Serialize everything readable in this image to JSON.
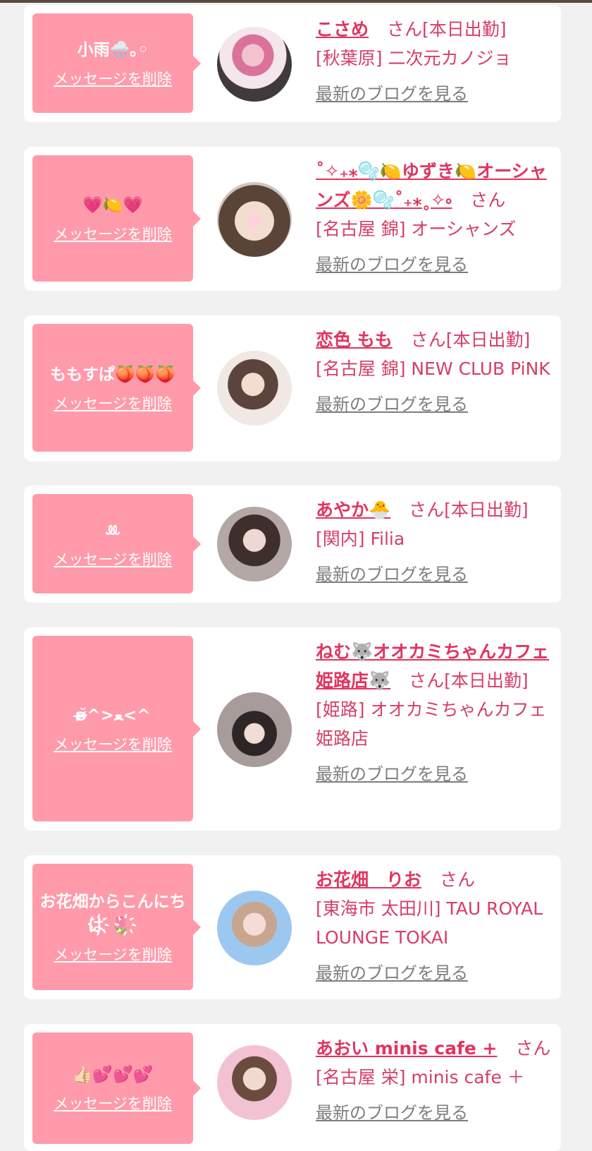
{
  "delete_label": "メッセージを削除",
  "blog_label": "最新のブログを見る",
  "colors": {
    "bubble": "#ff9aaa",
    "name": "#e0355f",
    "text": "#d63e66",
    "link": "#7d7d7d",
    "background": "#f2f1f1"
  },
  "entries": [
    {
      "message": "小雨🌧️｡◦",
      "name": "こさめ",
      "honorific": "さん",
      "status": "[本日出勤]",
      "shop": "[秋葉原] 二次元カノジョ"
    },
    {
      "message": "💗🍋💗",
      "name": "˚✧₊⁎🫧🍋ゆずき🍋オーシャンズ🌼🫧˚₊⁎˳✧༚",
      "honorific": "さん",
      "status": "",
      "shop": "[名古屋 錦] オーシャンズ"
    },
    {
      "message": "ももすぱ🍑🍑🍑",
      "name": "恋色 もも",
      "honorific": "さん",
      "status": "[本日出勤]",
      "shop": "[名古屋 錦] NEW CLUB PiNK"
    },
    {
      "message": "ꔛ‬",
      "name": "あやか🐣",
      "honorific": "さん",
      "status": "[本日出勤]",
      "shop": "[関内] Filia"
    },
    {
      "message": "ʚ̴̶̷̆^>ﻌ<^",
      "name": "ねむ🐺オオカミちゃんカフェ姫路店🐺",
      "honorific": "さん",
      "status": "[本日出勤]",
      "shop": "[姫路] オオカミちゃんカフェ姫路店"
    },
    {
      "message": "お花畑からこんにちは҉🌷҉",
      "name": "お花畑　りお",
      "honorific": "さん",
      "status": "",
      "shop": "[東海市 太田川] TAU ROYAL LOUNGE TOKAI"
    },
    {
      "message": "👍🏻💕💕💕",
      "name": "あおい minis cafe +",
      "honorific": "さん",
      "status": "",
      "shop": "[名古屋 栄] minis cafe ＋"
    }
  ]
}
